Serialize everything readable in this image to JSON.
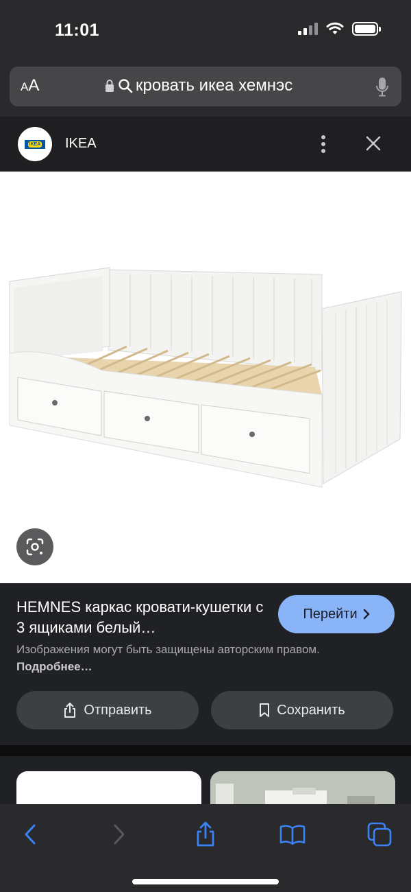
{
  "status_bar": {
    "time": "11:01"
  },
  "address_bar": {
    "aa_small": "A",
    "aa_large": "A",
    "url_text": "кровать икеа хемнэс"
  },
  "site": {
    "logo_text": "IKEA",
    "name": "IKEA"
  },
  "result": {
    "title": "HEMNES каркас кровати-кушетки с 3 ящиками белый…",
    "go_label": "Перейти",
    "copyright_text": "Изображения могут быть защищены авторским правом.",
    "more_link": "Подробнее…",
    "share_label": "Отправить",
    "save_label": "Сохранить"
  },
  "colors": {
    "accent": "#8ab4f8",
    "toolbar_blue": "#3b82f6",
    "panel": "#202124"
  }
}
